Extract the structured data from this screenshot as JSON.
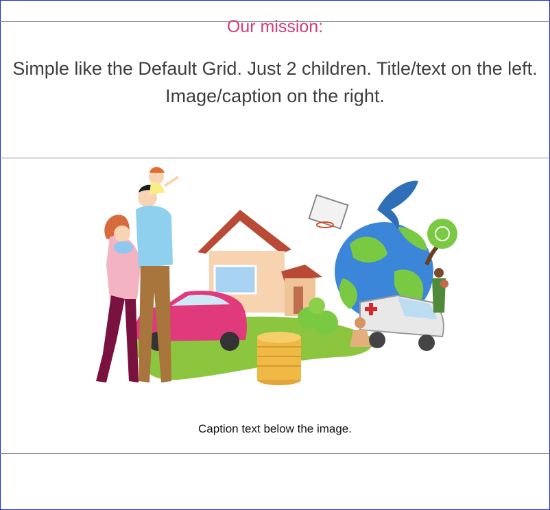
{
  "mission": {
    "title": "Our mission:",
    "body": "Simple like the Default Grid. Just 2 children. Title/text on the left. Image/caption on the right."
  },
  "figure": {
    "caption": "Caption text below the image.",
    "image_subject": "family-home-world-illustration"
  },
  "colors": {
    "title": "#d53a7a",
    "body_text": "#3d3d3d",
    "frame_border": "#1a2bd6",
    "divider": "#8a8a8a"
  }
}
